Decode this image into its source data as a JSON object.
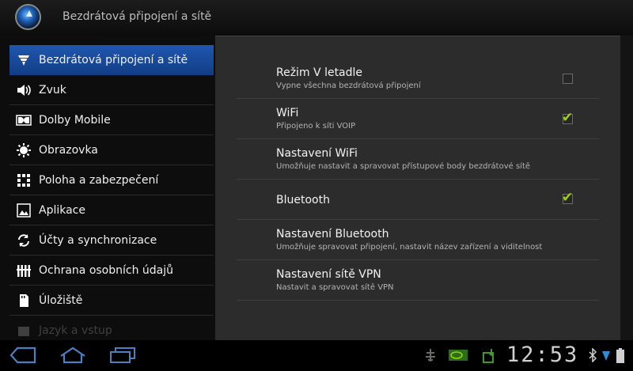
{
  "window": {
    "title": "Bezdrátová připojení a sítě"
  },
  "sidebar": {
    "items": [
      {
        "label": "Bezdrátová připojení a sítě",
        "icon": "wifi-icon"
      },
      {
        "label": "Zvuk",
        "icon": "speaker-icon"
      },
      {
        "label": "Dolby Mobile",
        "icon": "dolby-icon"
      },
      {
        "label": "Obrazovka",
        "icon": "brightness-icon"
      },
      {
        "label": "Poloha a zabezpečení",
        "icon": "location-grid-icon"
      },
      {
        "label": "Aplikace",
        "icon": "apps-icon"
      },
      {
        "label": "Účty a synchronizace",
        "icon": "sync-icon"
      },
      {
        "label": "Ochrana osobních údajů",
        "icon": "privacy-icon"
      },
      {
        "label": "Úložiště",
        "icon": "storage-icon"
      },
      {
        "label": "Jazyk a vstup",
        "icon": "language-icon"
      }
    ]
  },
  "settings": {
    "airplane": {
      "title": "Režim V letadle",
      "subtitle": "Vypne všechna bezdrátová připojení",
      "checked": false
    },
    "wifi": {
      "title": "WiFi",
      "subtitle": "Připojeno k síti VOIP",
      "checked": true
    },
    "wifi_settings": {
      "title": "Nastavení WiFi",
      "subtitle": "Umožňuje nastavit a spravovat přístupové body bezdrátové sítě"
    },
    "bluetooth": {
      "title": "Bluetooth",
      "checked": true
    },
    "bluetooth_settings": {
      "title": "Nastavení Bluetooth",
      "subtitle": "Umožňuje spravovat připojení, nastavit název zařízení a viditelnost"
    },
    "vpn_settings": {
      "title": "Nastavení sítě VPN",
      "subtitle": "Nastavit a spravovat sítě VPN"
    }
  },
  "status": {
    "time": "12:53"
  },
  "colors": {
    "accent": "#1f57b0",
    "check": "#9bd30a",
    "panel": "#2c2c2c"
  }
}
